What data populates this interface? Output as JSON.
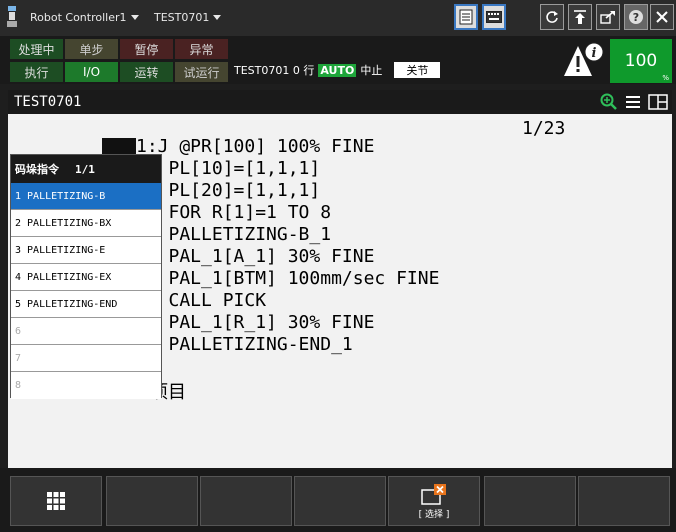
{
  "titlebar": {
    "controller": "Robot Controller1",
    "program": "TEST0701"
  },
  "status": {
    "cells": [
      {
        "label": "处理中",
        "tone": "green"
      },
      {
        "label": "单步",
        "tone": "olive"
      },
      {
        "label": "暂停",
        "tone": "red"
      },
      {
        "label": "异常",
        "tone": "red"
      },
      {
        "label": "执行",
        "tone": "green"
      },
      {
        "label": "I/O",
        "tone": "lgreen"
      },
      {
        "label": "运转",
        "tone": "green"
      },
      {
        "label": "试运行",
        "tone": "olive"
      }
    ],
    "line_prefix": "TEST0701 0 行",
    "mode": "AUTO",
    "state": "中止",
    "coord": "关节",
    "override": "100",
    "override_unit": "%"
  },
  "header": {
    "title": "TEST0701"
  },
  "editor": {
    "position": "1/23",
    "lines": [
      "1:J @PR[100] 100% FINE",
      "   PL[10]=[1,1,1]",
      "   PL[20]=[1,1,1]",
      "   FOR R[1]=1 TO 8",
      "   PALLETIZING-B_1",
      " J PAL_1[A_1] 30% FINE",
      " L PAL_1[BTM] 100mm/sec FINE",
      "   CALL PICK",
      " J PAL_1[R_1] 30% FINE",
      "   PALLETIZING-END_1"
    ],
    "tail": "项目"
  },
  "popup": {
    "title": "码垛指令",
    "page": "1/1",
    "items": [
      "1 PALLETIZING-B",
      "2 PALLETIZING-BX",
      "3 PALLETIZING-E",
      "4 PALLETIZING-EX",
      "5 PALLETIZING-END",
      "6",
      "7",
      "8"
    ]
  },
  "bottom": {
    "select_label": "[ 选择 ]"
  },
  "colors": {
    "accent_blue": "#1b6fc4",
    "auto_green": "#1ea53a",
    "override_green": "#0f9a2c"
  }
}
